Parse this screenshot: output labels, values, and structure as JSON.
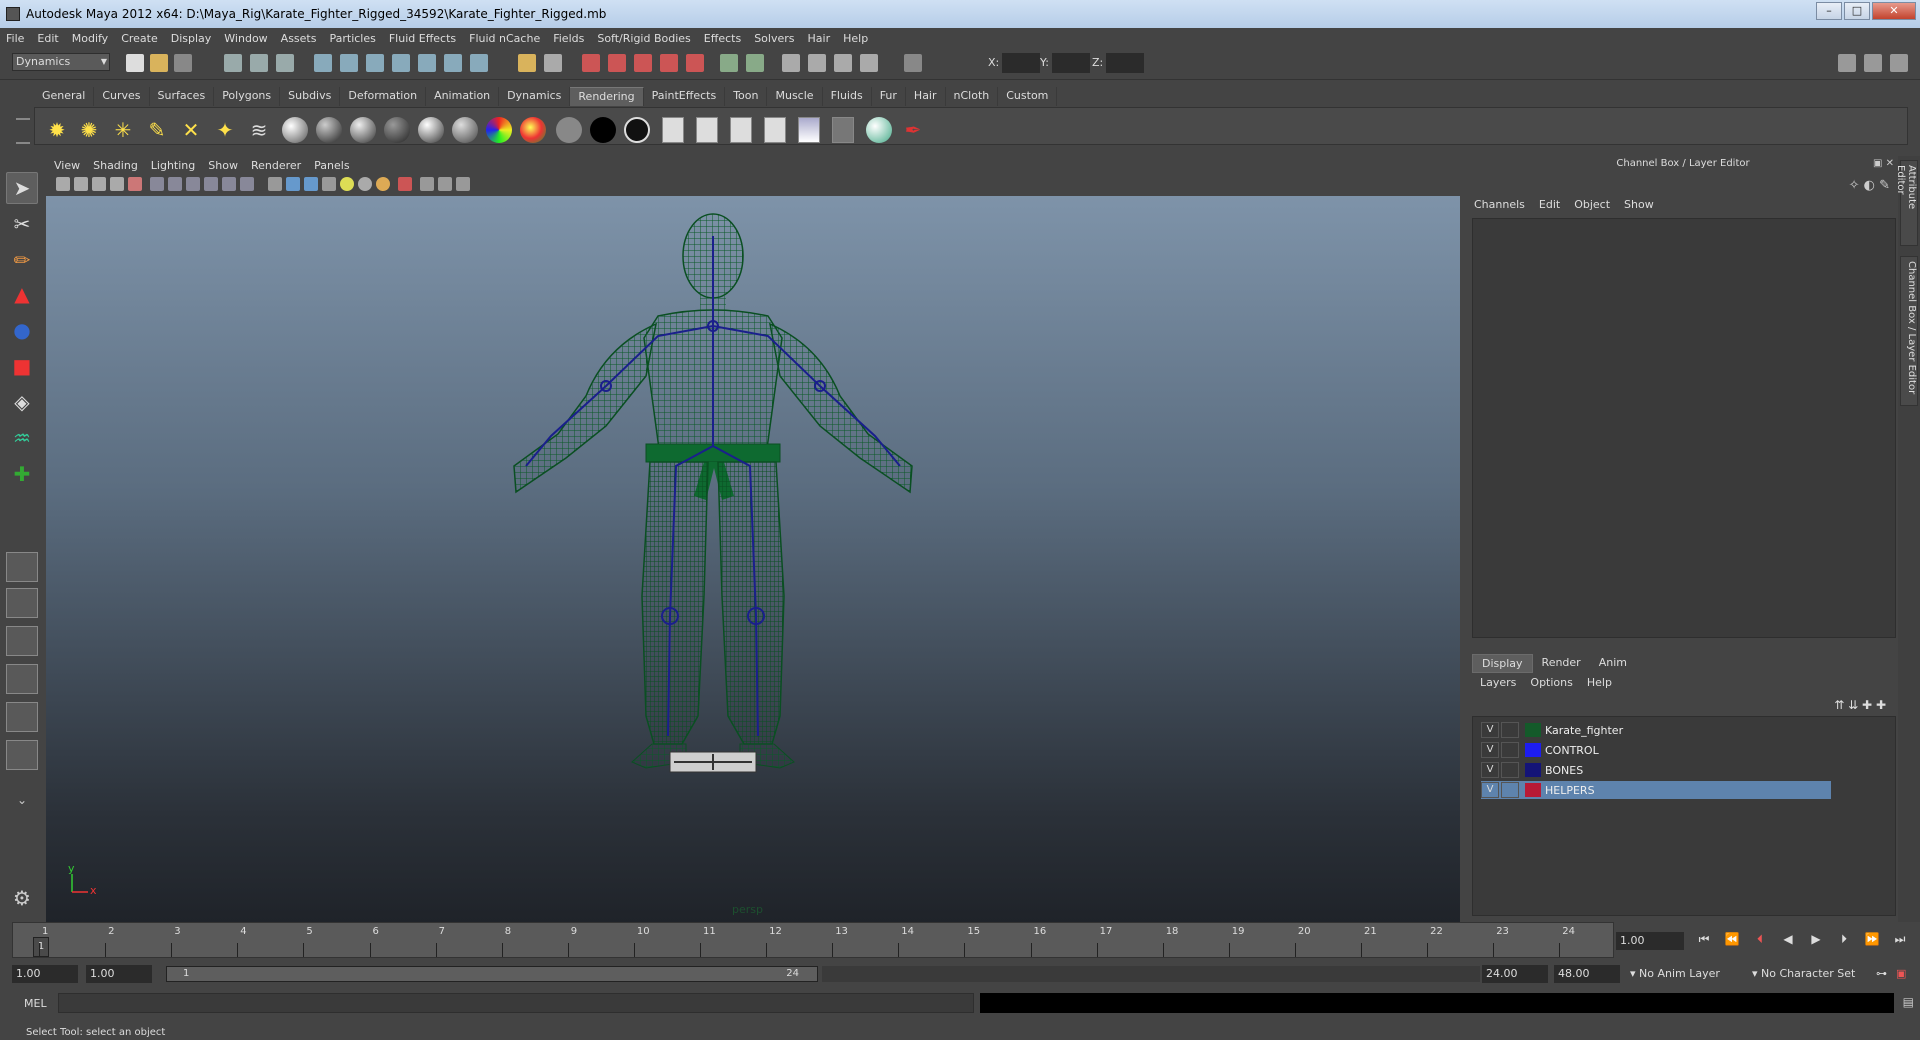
{
  "window": {
    "title": "Autodesk Maya 2012 x64: D:\\Maya_Rig\\Karate_Fighter_Rigged_34592\\Karate_Fighter_Rigged.mb"
  },
  "menubar": {
    "items": [
      "File",
      "Edit",
      "Modify",
      "Create",
      "Display",
      "Window",
      "Assets",
      "Particles",
      "Fluid Effects",
      "Fluid nCache",
      "Fields",
      "Soft/Rigid Bodies",
      "Effects",
      "Solvers",
      "Hair",
      "Help"
    ]
  },
  "statusline": {
    "mode": "Dynamics",
    "x_label": "X:",
    "y_label": "Y:",
    "z_label": "Z:"
  },
  "shelf": {
    "tabs": [
      "General",
      "Curves",
      "Surfaces",
      "Polygons",
      "Subdivs",
      "Deformation",
      "Animation",
      "Dynamics",
      "Rendering",
      "PaintEffects",
      "Toon",
      "Muscle",
      "Fluids",
      "Fur",
      "Hair",
      "nCloth",
      "Custom"
    ],
    "active_tab": "Rendering"
  },
  "viewport": {
    "menus": [
      "View",
      "Shading",
      "Lighting",
      "Show",
      "Renderer",
      "Panels"
    ],
    "camera": "persp",
    "axis_x": "x",
    "axis_y": "y",
    "colors": {
      "mesh": "#0e5a2a",
      "bones": "#1a1f8c",
      "bg_top": "#7e93a9",
      "bg_bottom": "#1f2329"
    }
  },
  "channelbox": {
    "title": "Channel Box / Layer Editor",
    "menus": [
      "Channels",
      "Edit",
      "Object",
      "Show"
    ]
  },
  "layer_editor": {
    "tabs": [
      "Display",
      "Render",
      "Anim"
    ],
    "active_tab": "Display",
    "menus": [
      "Layers",
      "Options",
      "Help"
    ],
    "layers": [
      {
        "visible": "V",
        "name": "Karate_fighter",
        "color": "#145a2a",
        "selected": false
      },
      {
        "visible": "V",
        "name": "CONTROL",
        "color": "#1d1df0",
        "selected": false
      },
      {
        "visible": "V",
        "name": "BONES",
        "color": "#141478",
        "selected": false
      },
      {
        "visible": "V",
        "name": "HELPERS",
        "color": "#b81a36",
        "selected": true
      }
    ]
  },
  "side_tabs": [
    "Attribute Editor",
    "Channel Box / Layer Editor"
  ],
  "timeslider": {
    "ticks": [
      "1",
      "2",
      "3",
      "4",
      "5",
      "6",
      "7",
      "8",
      "9",
      "10",
      "11",
      "12",
      "13",
      "14",
      "15",
      "16",
      "17",
      "18",
      "19",
      "20",
      "21",
      "22",
      "23",
      "24"
    ],
    "current": "1",
    "current_frame_field": "1.00"
  },
  "range": {
    "start": "1.00",
    "playback_start": "1.00",
    "bar_start": "1",
    "bar_end": "24",
    "playback_end": "24.00",
    "end": "48.00",
    "anim_layer": "No Anim Layer",
    "character_set": "No Character Set"
  },
  "cmdline": {
    "label": "MEL"
  },
  "helpline": {
    "text": "Select Tool: select an object"
  }
}
